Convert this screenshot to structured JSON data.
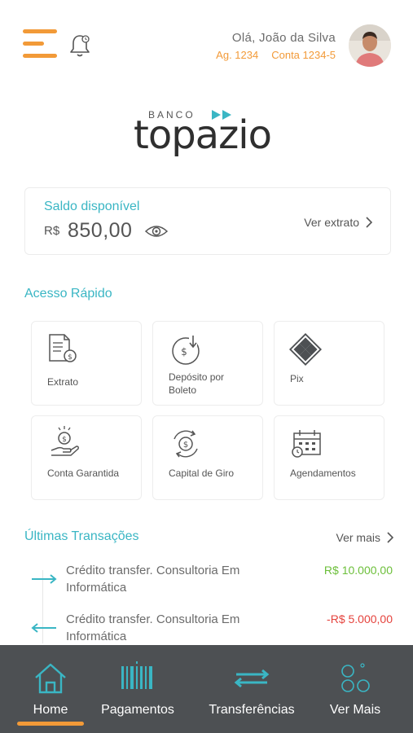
{
  "header": {
    "greeting": "Olá, João da Silva",
    "agency": "Ag. 1234",
    "account": "Conta 1234-5"
  },
  "logo": {
    "banco": "BANCO",
    "name": "topazio"
  },
  "balance": {
    "label": "Saldo disponível",
    "currency": "R$",
    "value": "850,00",
    "statement_link": "Ver extrato"
  },
  "quick_access": {
    "title": "Acesso Rápido",
    "items": [
      {
        "label": "Extrato",
        "icon": "statement-icon"
      },
      {
        "label": "Depósito por Boleto",
        "icon": "deposit-icon"
      },
      {
        "label": "Pix",
        "icon": "pix-icon"
      },
      {
        "label": "Conta Garantida",
        "icon": "guaranteed-account-icon"
      },
      {
        "label": "Capital de Giro",
        "icon": "working-capital-icon"
      },
      {
        "label": "Agendamentos",
        "icon": "calendar-icon"
      }
    ]
  },
  "transactions": {
    "title": "Últimas Transações",
    "more_label": "Ver mais",
    "items": [
      {
        "description": "Crédito transfer. Consultoria Em Informática",
        "amount": "R$ 10.000,00",
        "color": "#6cbf3a"
      },
      {
        "description": "Crédito transfer. Consultoria Em Informática",
        "amount": "-R$ 5.000,00",
        "color": "#e5433d"
      }
    ]
  },
  "bottom_nav": {
    "items": [
      {
        "label": "Home",
        "icon": "home-icon",
        "active": true
      },
      {
        "label": "Pagamentos",
        "icon": "barcode-icon",
        "active": false
      },
      {
        "label": "Transferências",
        "icon": "transfer-icon",
        "active": false
      },
      {
        "label": "Ver Mais",
        "icon": "more-circles-icon",
        "active": false
      }
    ]
  },
  "colors": {
    "accent_orange": "#f29a38",
    "accent_teal": "#3ab6c4",
    "nav_background": "#4d5053",
    "positive": "#6cbf3a",
    "negative": "#e5433d"
  }
}
